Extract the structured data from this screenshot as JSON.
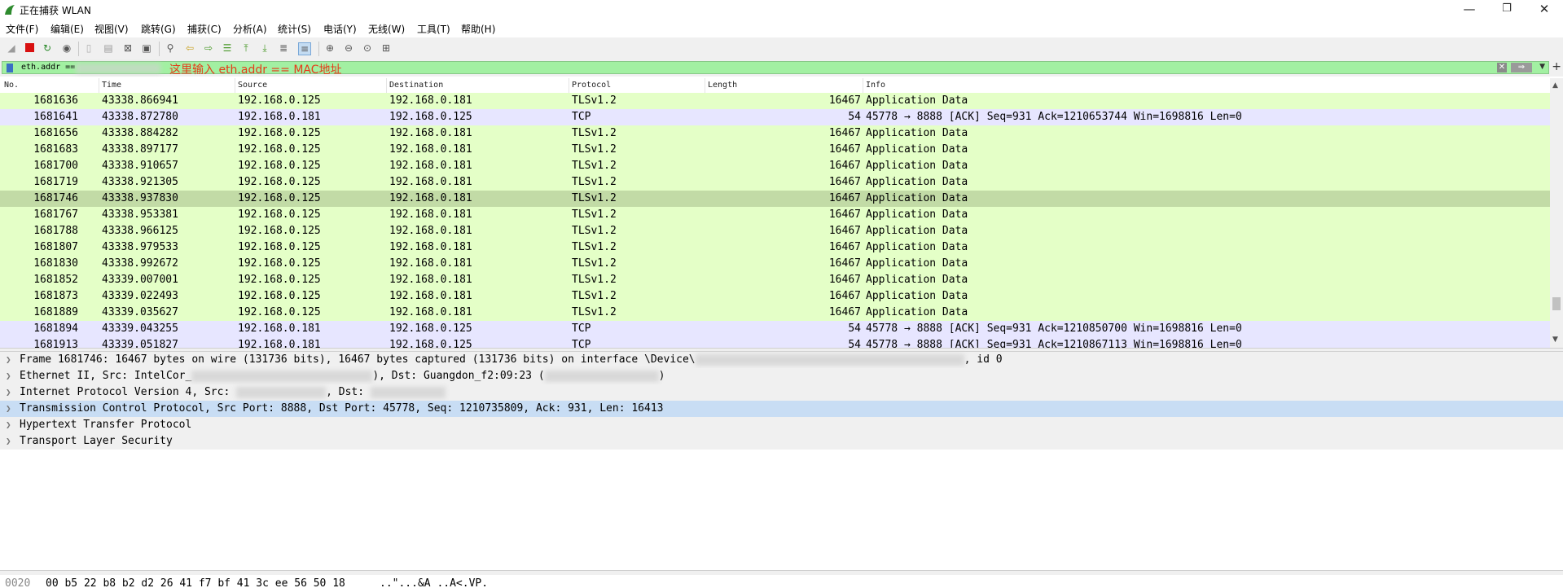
{
  "window": {
    "title": "正在捕获 WLAN",
    "minimize": "—",
    "restore": "❐",
    "close": "✕"
  },
  "menu": [
    "文件(F)",
    "编辑(E)",
    "视图(V)",
    "跳转(G)",
    "捕获(C)",
    "分析(A)",
    "统计(S)",
    "电话(Y)",
    "无线(W)",
    "工具(T)",
    "帮助(H)"
  ],
  "filter": {
    "value": "eth.addr ==",
    "annotation": "这里输入 eth.addr == MAC地址"
  },
  "columns": [
    "No.",
    "Time",
    "Source",
    "Destination",
    "Protocol",
    "Length",
    "Info"
  ],
  "packets": [
    {
      "no": "1681636",
      "time": "43338.866941",
      "src": "192.168.0.125",
      "dst": "192.168.0.181",
      "proto": "TLSv1.2",
      "len": "16467",
      "info": "Application Data",
      "bg": "#e4ffc7"
    },
    {
      "no": "1681641",
      "time": "43338.872780",
      "src": "192.168.0.181",
      "dst": "192.168.0.125",
      "proto": "TCP",
      "len": "54",
      "info": "45778 → 8888 [ACK] Seq=931 Ack=1210653744 Win=1698816 Len=0",
      "bg": "#e7e6ff"
    },
    {
      "no": "1681656",
      "time": "43338.884282",
      "src": "192.168.0.125",
      "dst": "192.168.0.181",
      "proto": "TLSv1.2",
      "len": "16467",
      "info": "Application Data",
      "bg": "#e4ffc7"
    },
    {
      "no": "1681683",
      "time": "43338.897177",
      "src": "192.168.0.125",
      "dst": "192.168.0.181",
      "proto": "TLSv1.2",
      "len": "16467",
      "info": "Application Data",
      "bg": "#e4ffc7"
    },
    {
      "no": "1681700",
      "time": "43338.910657",
      "src": "192.168.0.125",
      "dst": "192.168.0.181",
      "proto": "TLSv1.2",
      "len": "16467",
      "info": "Application Data",
      "bg": "#e4ffc7"
    },
    {
      "no": "1681719",
      "time": "43338.921305",
      "src": "192.168.0.125",
      "dst": "192.168.0.181",
      "proto": "TLSv1.2",
      "len": "16467",
      "info": "Application Data",
      "bg": "#e4ffc7"
    },
    {
      "no": "1681746",
      "time": "43338.937830",
      "src": "192.168.0.125",
      "dst": "192.168.0.181",
      "proto": "TLSv1.2",
      "len": "16467",
      "info": "Application Data",
      "bg": "#c2dba6"
    },
    {
      "no": "1681767",
      "time": "43338.953381",
      "src": "192.168.0.125",
      "dst": "192.168.0.181",
      "proto": "TLSv1.2",
      "len": "16467",
      "info": "Application Data",
      "bg": "#e4ffc7"
    },
    {
      "no": "1681788",
      "time": "43338.966125",
      "src": "192.168.0.125",
      "dst": "192.168.0.181",
      "proto": "TLSv1.2",
      "len": "16467",
      "info": "Application Data",
      "bg": "#e4ffc7"
    },
    {
      "no": "1681807",
      "time": "43338.979533",
      "src": "192.168.0.125",
      "dst": "192.168.0.181",
      "proto": "TLSv1.2",
      "len": "16467",
      "info": "Application Data",
      "bg": "#e4ffc7"
    },
    {
      "no": "1681830",
      "time": "43338.992672",
      "src": "192.168.0.125",
      "dst": "192.168.0.181",
      "proto": "TLSv1.2",
      "len": "16467",
      "info": "Application Data",
      "bg": "#e4ffc7"
    },
    {
      "no": "1681852",
      "time": "43339.007001",
      "src": "192.168.0.125",
      "dst": "192.168.0.181",
      "proto": "TLSv1.2",
      "len": "16467",
      "info": "Application Data",
      "bg": "#e4ffc7"
    },
    {
      "no": "1681873",
      "time": "43339.022493",
      "src": "192.168.0.125",
      "dst": "192.168.0.181",
      "proto": "TLSv1.2",
      "len": "16467",
      "info": "Application Data",
      "bg": "#e4ffc7"
    },
    {
      "no": "1681889",
      "time": "43339.035627",
      "src": "192.168.0.125",
      "dst": "192.168.0.181",
      "proto": "TLSv1.2",
      "len": "16467",
      "info": "Application Data",
      "bg": "#e4ffc7"
    },
    {
      "no": "1681894",
      "time": "43339.043255",
      "src": "192.168.0.181",
      "dst": "192.168.0.125",
      "proto": "TCP",
      "len": "54",
      "info": "45778 → 8888 [ACK] Seq=931 Ack=1210850700 Win=1698816 Len=0",
      "bg": "#e7e6ff"
    },
    {
      "no": "1681913",
      "time": "43339.051827",
      "src": "192.168.0.181",
      "dst": "192.168.0.125",
      "proto": "TCP",
      "len": "54",
      "info": "45778 → 8888 [ACK] Seq=931 Ack=1210867113 Win=1698816 Len=0",
      "bg": "#e7e6ff"
    }
  ],
  "details": [
    {
      "text": "Frame 1681746: 16467 bytes on wire (131736 bits), 16467 bytes captured (131736 bits) on interface \\Device\\",
      "tail": ", id 0"
    },
    {
      "text": "Ethernet II, Src: IntelCor_",
      "tail": "), Dst: Guangdon_f2:09:23 ("
    },
    {
      "text": "Internet Protocol Version 4, Src: ",
      "tail": ", Dst: "
    },
    {
      "text": "Transmission Control Protocol, Src Port: 8888, Dst Port: 45778, Seq: 1210735809, Ack: 931, Len: 16413",
      "tail": ""
    },
    {
      "text": "Hypertext Transfer Protocol",
      "tail": ""
    },
    {
      "text": "Transport Layer Security",
      "tail": ""
    }
  ],
  "bytes": {
    "offset": "0020",
    "hex": "00 b5 22 b8 b2 d2 26 41  f7 bf 41 3c ee 56 50 18",
    "ascii": "..\"...&A ..A<.VP."
  },
  "colors": {
    "tls_row": "#e4ffc7",
    "tcp_row": "#e7e6ff",
    "selected_row": "#c2dba6",
    "filter_bg": "#a2f0a2",
    "annotation": "#e63a1a",
    "detail_selected": "#c8ddf4"
  }
}
